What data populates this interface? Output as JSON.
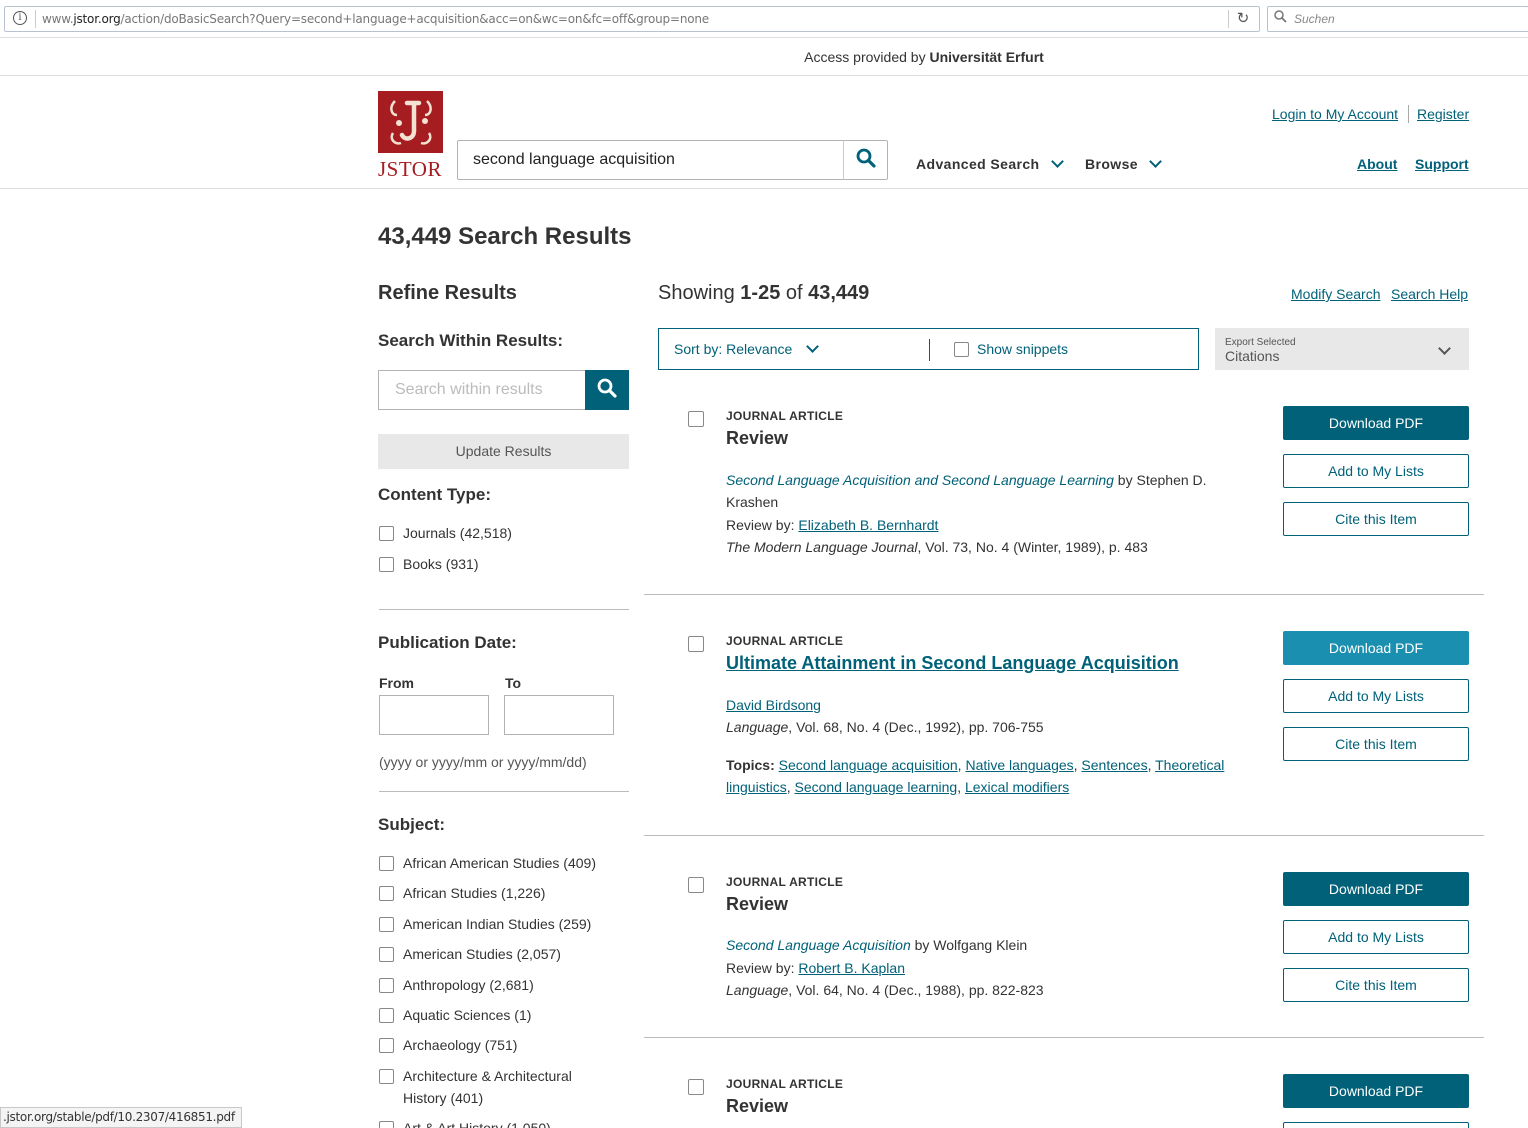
{
  "browser": {
    "url_prefix": "www.",
    "url_domain": "jstor.org",
    "url_rest": "/action/doBasicSearch?Query=second+language+acquisition&acc=on&wc=on&fc=off&group=none",
    "search_placeholder": "Suchen",
    "status_url": ".jstor.org/stable/pdf/10.2307/416851.pdf"
  },
  "access": {
    "prefix": "Access provided by ",
    "institution": "Universität Erfurt"
  },
  "header": {
    "logo_text": "JSTOR",
    "search_value": "second language acquisition",
    "nav": [
      "Advanced Search",
      "Browse"
    ],
    "login": "Login to My Account",
    "register": "Register",
    "about": "About",
    "support": "Support"
  },
  "results_heading": "43,449 Search Results",
  "sidebar": {
    "refine": "Refine Results",
    "within_title": "Search Within Results:",
    "within_placeholder": "Search within results",
    "update": "Update Results",
    "content_type_title": "Content Type:",
    "content_types": [
      "Journals (42,518)",
      "Books (931)"
    ],
    "pub_date_title": "Publication Date:",
    "from": "From",
    "to": "To",
    "date_hint": "(yyyy or yyyy/mm or yyyy/mm/dd)",
    "subject_title": "Subject:",
    "subjects": [
      "African American Studies (409)",
      "African Studies (1,226)",
      "American Indian Studies (259)",
      "American Studies (2,057)",
      "Anthropology (2,681)",
      "Aquatic Sciences (1)",
      "Archaeology (751)",
      "Architecture & Architectural History (401)",
      "Art & Art History (1,050)"
    ]
  },
  "results": {
    "showing_prefix": "Showing ",
    "showing_range": "1-25",
    "showing_of": " of ",
    "showing_total": "43,449",
    "modify": "Modify Search",
    "help": "Search Help",
    "sort": "Sort by: Relevance",
    "snippets": "Show snippets",
    "export_small": "Export Selected",
    "export_big": "Citations",
    "buttons": {
      "pdf": "Download PDF",
      "lists": "Add to My Lists",
      "cite": "Cite this Item"
    },
    "items": [
      {
        "type": "JOURNAL ARTICLE",
        "title": "Review",
        "reviewed_title": "Second Language Acquisition and Second Language Learning",
        "reviewed_by_word": " by Stephen D.",
        "reviewed_author_rest": "Krashen",
        "review_by_label": "Review by: ",
        "reviewer": "Elizabeth B. Bernhardt",
        "journal": "The Modern Language Journal",
        "citation": ", Vol. 73, No. 4 (Winter, 1989), p. 483"
      },
      {
        "type": "JOURNAL ARTICLE",
        "title": "Ultimate Attainment in Second Language Acquisition",
        "author": "David Birdsong",
        "journal": "Language",
        "citation": ", Vol. 68, No. 4 (Dec., 1992), pp. 706-755",
        "topics_label": "Topics:",
        "topics": [
          "Second language acquisition",
          "Native languages",
          "Sentences",
          "Theoretical linguistics",
          "Second language learning",
          "Lexical modifiers"
        ]
      },
      {
        "type": "JOURNAL ARTICLE",
        "title": "Review",
        "reviewed_title": "Second Language Acquisition",
        "reviewed_by_word": " by Wolfgang Klein",
        "review_by_label": "Review by: ",
        "reviewer": "Robert B. Kaplan",
        "journal": "Language",
        "citation": ", Vol. 64, No. 4 (Dec., 1988), pp. 822-823"
      },
      {
        "type": "JOURNAL ARTICLE",
        "title": "Review"
      }
    ]
  },
  "colors": {
    "accent": "#006179",
    "brand": "#a51d21",
    "hover": "#1a8fb0"
  }
}
